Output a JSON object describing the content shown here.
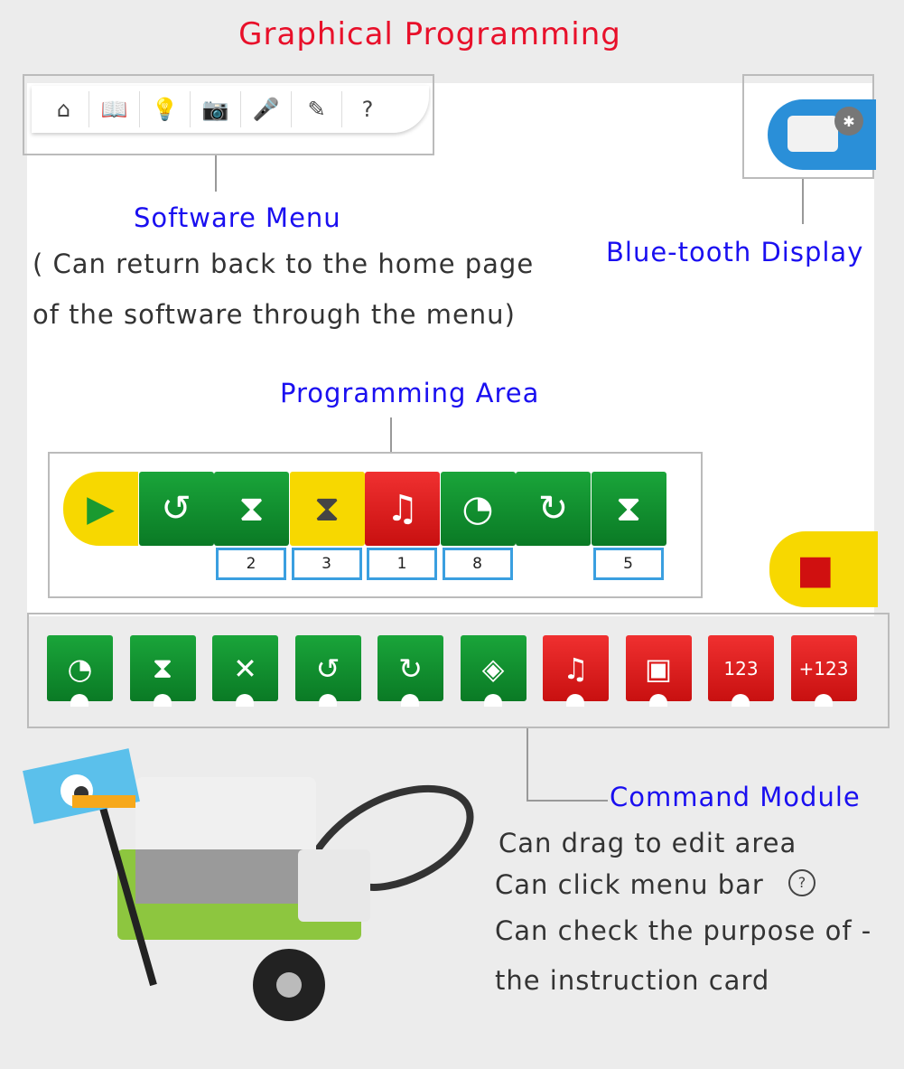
{
  "title": "Graphical Programming",
  "menu": {
    "label": "Software Menu",
    "desc1": "( Can return back to the home page",
    "desc2": "of the software through the menu)",
    "icons": [
      "home-icon",
      "book-icon",
      "lightbulb-icon",
      "camera-icon",
      "microphone-icon",
      "pencil-icon",
      "help-icon"
    ],
    "glyphs": [
      "⌂",
      "📖",
      "💡",
      "📷",
      "🎤",
      "✎",
      "?"
    ]
  },
  "bluetooth": {
    "label": "Blue-tooth Display",
    "glyph": "✱"
  },
  "programming": {
    "label": "Programming Area",
    "blocks": [
      {
        "kind": "start",
        "glyph": "▶",
        "color": "#f7d800"
      },
      {
        "kind": "motor-counterclockwise",
        "glyph": "↺"
      },
      {
        "kind": "motor-on-for",
        "glyph": "⧗",
        "value": "2"
      },
      {
        "kind": "wait",
        "glyph": "⧗",
        "value": "3"
      },
      {
        "kind": "play-sound",
        "glyph": "♫",
        "value": "1"
      },
      {
        "kind": "motor-power",
        "glyph": "◔",
        "value": "8"
      },
      {
        "kind": "motor-clockwise",
        "glyph": "↻"
      },
      {
        "kind": "motor-on-for",
        "glyph": "⧗",
        "value": "5"
      }
    ],
    "stop_glyph": "■"
  },
  "commands": {
    "label": "Command Module",
    "tiles": [
      {
        "kind": "motor-power",
        "glyph": "◔",
        "c": "g"
      },
      {
        "kind": "motor-on-for",
        "glyph": "⧗",
        "c": "g"
      },
      {
        "kind": "motor-off",
        "glyph": "✕",
        "c": "g"
      },
      {
        "kind": "motor-counterclockwise",
        "glyph": "↺",
        "c": "g"
      },
      {
        "kind": "motor-clockwise",
        "glyph": "↻",
        "c": "g"
      },
      {
        "kind": "light",
        "glyph": "◈",
        "c": "g"
      },
      {
        "kind": "play-sound",
        "glyph": "♫",
        "c": "r"
      },
      {
        "kind": "display-image",
        "glyph": "▣",
        "c": "r"
      },
      {
        "kind": "display-number",
        "glyph": "123",
        "c": "r"
      },
      {
        "kind": "add-display-number",
        "glyph": "+123",
        "c": "r"
      }
    ],
    "desc": [
      "Can drag to edit area",
      "Can click menu bar",
      "Can check the purpose of -",
      "the instruction card"
    ]
  },
  "colors": {
    "title": "#e8102a",
    "label": "#1a0ff0",
    "green": "#1aa53a",
    "red": "#e02020",
    "yellow": "#f7d800",
    "blue": "#2a8fd8"
  }
}
